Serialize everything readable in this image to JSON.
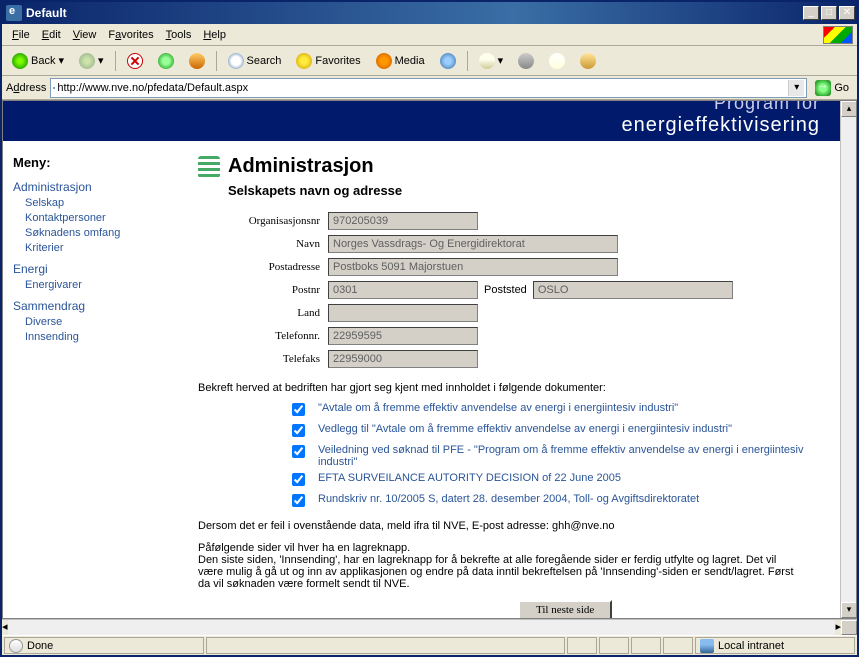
{
  "titlebar": {
    "title": "Default"
  },
  "winbtns": {
    "min": "_",
    "max": "□",
    "close": "✕"
  },
  "menubar": {
    "file": "File",
    "edit": "Edit",
    "view": "View",
    "favorites": "Favorites",
    "tools": "Tools",
    "help": "Help"
  },
  "toolbar": {
    "back": "Back",
    "search": "Search",
    "favorites": "Favorites",
    "media": "Media"
  },
  "addressbar": {
    "label": "Address",
    "url": "http://www.nve.no/pfedata/Default.aspx",
    "go": "Go"
  },
  "banner": {
    "line1": "Program for",
    "line2": "energieffektivisering"
  },
  "meny": {
    "title": "Meny:",
    "groups": [
      {
        "label": "Administrasjon",
        "items": [
          "Selskap",
          "Kontaktpersoner",
          "Søknadens omfang",
          "Kriterier"
        ]
      },
      {
        "label": "Energi",
        "items": [
          "Energivarer"
        ]
      },
      {
        "label": "Sammendrag",
        "items": [
          "Diverse",
          "Innsending"
        ]
      }
    ]
  },
  "main": {
    "title": "Administrasjon",
    "subtitle": "Selskapets navn og adresse",
    "fields": {
      "orgnr": {
        "label": "Organisasjonsnr",
        "value": "970205039"
      },
      "navn": {
        "label": "Navn",
        "value": "Norges Vassdrags- Og Energidirektorat"
      },
      "postadr": {
        "label": "Postadresse",
        "value": "Postboks 5091 Majorstuen"
      },
      "postnr": {
        "label": "Postnr",
        "value": "0301"
      },
      "poststed": {
        "label": "Poststed",
        "value": "OSLO"
      },
      "land": {
        "label": "Land",
        "value": ""
      },
      "tlf": {
        "label": "Telefonnr.",
        "value": "22959595"
      },
      "fax": {
        "label": "Telefaks",
        "value": "22959000"
      }
    },
    "confirm": "Bekreft herved at bedriften har gjort seg kjent med innholdet i følgende dokumenter:",
    "docs": [
      "\"Avtale om å fremme effektiv anvendelse av energi i energiintesiv industri\"",
      "Vedlegg til \"Avtale om å fremme effektiv anvendelse av energi i energiintesiv industri\"",
      "Veiledning ved søknad til PFE - \"Program om å fremme effektiv anvendelse av energi i energiintesiv industri\"",
      "EFTA SURVEILANCE AUTORITY DECISION of 22 June 2005",
      "Rundskriv nr. 10/2005 S, datert 28. desember 2004, Toll- og Avgiftsdirektoratet"
    ],
    "info1": "Dersom det er feil i ovenstående data, meld ifra til NVE, E-post adresse: ghh@nve.no",
    "info2": "Påfølgende sider vil hver ha en lagreknapp.\nDen siste siden, 'Innsending', har en lagreknapp for å bekrefte at alle foregående sider er ferdig utfylte og lagret. Det vil være mulig å gå ut og inn av applikasjonen og endre på data inntil bekreftelsen på 'Innsending'-siden er sendt/lagret. Først da vil søknaden være formelt sendt til NVE.",
    "next": "Til neste side"
  },
  "statusbar": {
    "done": "Done",
    "zone": "Local intranet"
  }
}
